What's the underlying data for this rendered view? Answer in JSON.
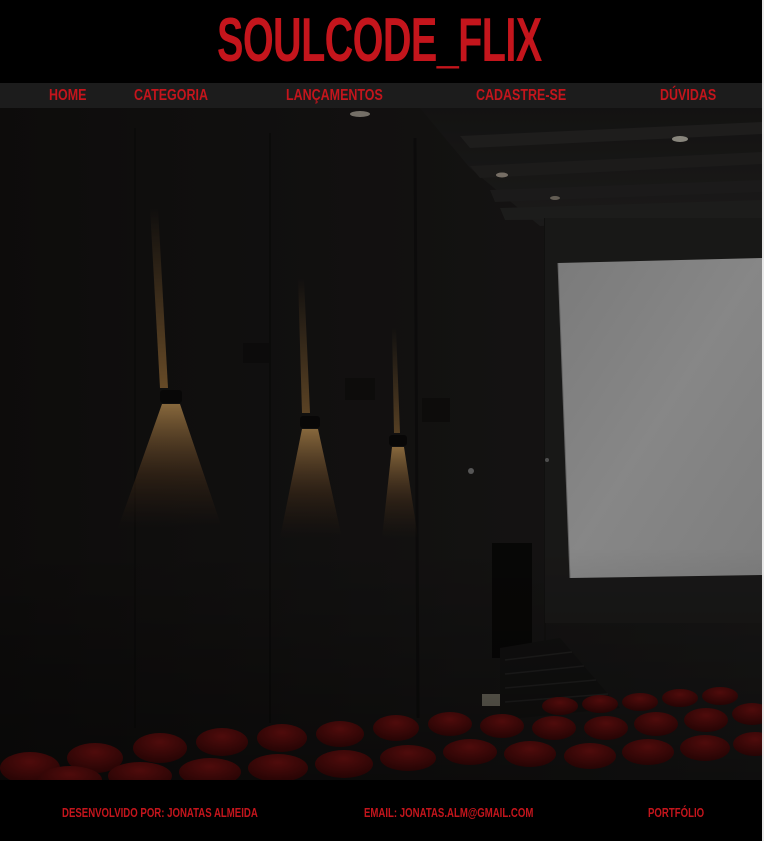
{
  "header": {
    "brand": "SOULCODE_FLIX"
  },
  "nav": {
    "items": [
      {
        "label": "HOME"
      },
      {
        "label": "CATEGORIA"
      },
      {
        "label": "LANÇAMENTOS"
      },
      {
        "label": "CADASTRE-SE"
      },
      {
        "label": "DÚVIDAS"
      }
    ]
  },
  "hero": {
    "image": "cinema-theater-photo"
  },
  "footer": {
    "developer": "DESENVOLVIDO POR: JONATAS ALMEIDA",
    "email": "EMAIL: JONATAS.ALM@GMAIL.COM",
    "portfolio": "PORTFÓLIO"
  },
  "colors": {
    "accent": "#c4151c",
    "nav_bg": "#1c1c1c",
    "page_bg": "#000000"
  }
}
